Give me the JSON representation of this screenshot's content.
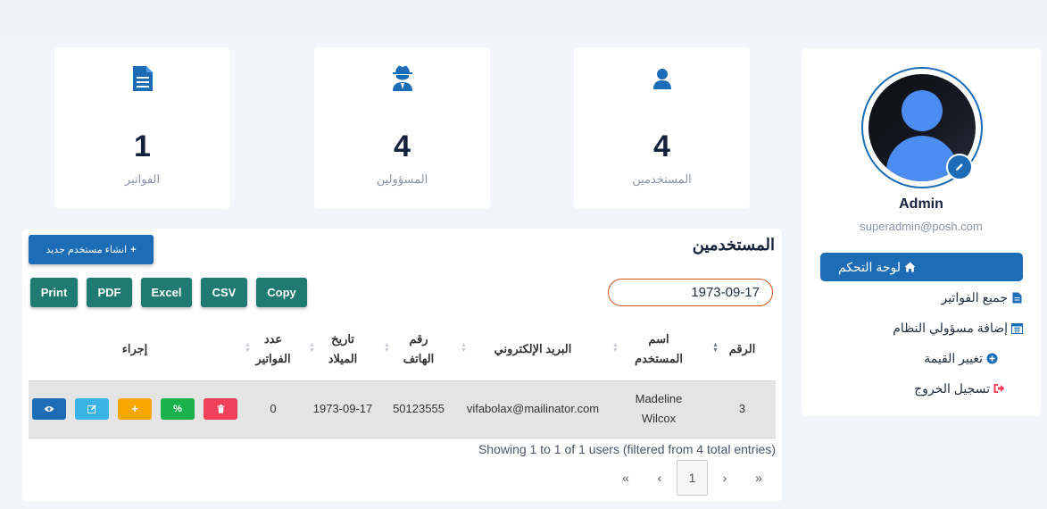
{
  "sidebar": {
    "admin_name": "Admin",
    "admin_email": "superadmin@posh.com",
    "menu": [
      {
        "label": "لوحة التحكم",
        "icon": "home-icon"
      },
      {
        "label": "جميع الفواتير",
        "icon": "file-icon"
      },
      {
        "label": "إضافة مسؤولي النظام",
        "icon": "calendar-icon"
      },
      {
        "label": "تغيير القيمة",
        "icon": "plus-circle-icon"
      },
      {
        "label": "تسجيل الخروج",
        "icon": "sign-out-icon"
      }
    ]
  },
  "stats": [
    {
      "value": "4",
      "label": "المستخدمين",
      "icon": "user-icon"
    },
    {
      "value": "4",
      "label": "المسؤولين",
      "icon": "user-secret-icon"
    },
    {
      "value": "1",
      "label": "الفواتير",
      "icon": "invoice-icon"
    }
  ],
  "panel": {
    "title": "المستخدمين",
    "create_button": "انشاء مستخدم جديد",
    "export_buttons": [
      "Copy",
      "CSV",
      "Excel",
      "PDF",
      "Print"
    ],
    "search_value": "1973-09-17",
    "columns": [
      "الرقم",
      "اسم المستخدم",
      "البريد الإلكتروني",
      "رقم الهاتف",
      "تاريخ الميلاد",
      "عدد الفواتير",
      "إجراء"
    ],
    "rows": [
      {
        "id": "3",
        "name": "Madeline Wilcox",
        "email": "vifabolax@mailinator.com",
        "phone": "50123555",
        "birth_date": "1973-09-17",
        "invoices": "0"
      }
    ],
    "info": "Showing 1 to 1 of 1 users (filtered from 4 total entries)",
    "pager": [
      "«",
      "‹",
      "1",
      "›",
      "»"
    ]
  },
  "colors": {
    "primary": "#1c6cb6",
    "export": "#1f7a72",
    "view": "#1c6cb6",
    "edit": "#3ab4e6",
    "add": "#f5a700",
    "percent": "#1ab34b",
    "delete": "#f0405a"
  }
}
